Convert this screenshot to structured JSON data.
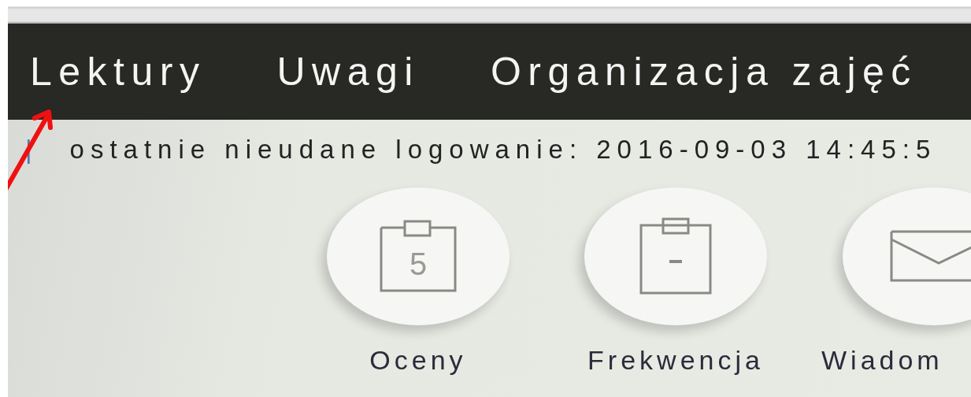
{
  "nav": [
    {
      "label": "Lektury"
    },
    {
      "label": "Uwagi"
    },
    {
      "label": "Organizacja zajęć"
    }
  ],
  "status": {
    "separator": "|",
    "text": "ostatnie nieudane logowanie: 2016-09-03 14:45:5"
  },
  "tiles": [
    {
      "kind": "grades",
      "icon_text": "5",
      "label": "Oceny"
    },
    {
      "kind": "attendance",
      "label": "Frekwencja"
    },
    {
      "kind": "messages",
      "label": "Wiadom"
    }
  ]
}
